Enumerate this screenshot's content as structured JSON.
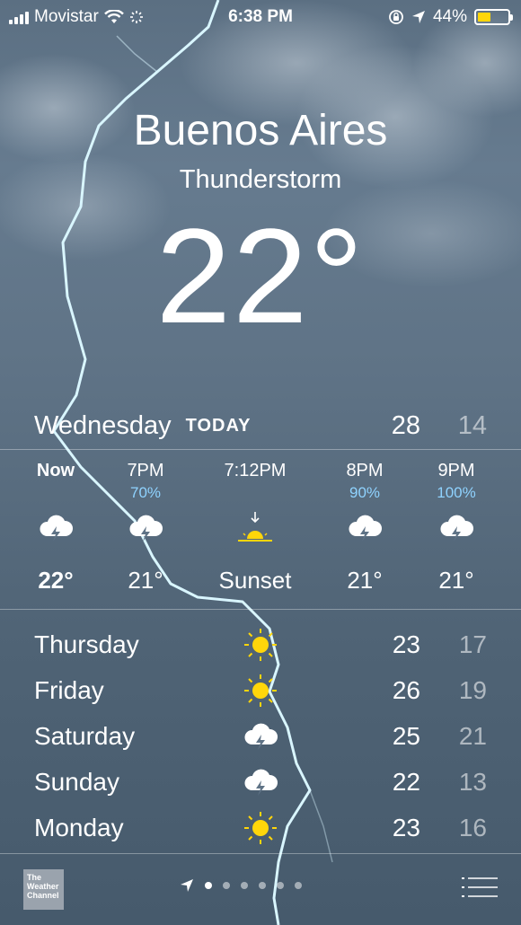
{
  "status_bar": {
    "carrier": "Movistar",
    "time": "6:38 PM",
    "battery_percent": "44%",
    "battery_level": 0.44,
    "icons": [
      "signal-icon",
      "wifi-icon",
      "activity-icon",
      "orientation-lock-icon",
      "location-arrow-icon",
      "battery-icon"
    ]
  },
  "location": {
    "city": "Buenos Aires",
    "condition": "Thunderstorm",
    "temperature": "22°"
  },
  "today": {
    "day": "Wednesday",
    "tag": "TODAY",
    "high": "28",
    "low": "14"
  },
  "hourly": [
    {
      "time": "Now",
      "precip": "",
      "icon": "thunderstorm-icon",
      "temp": "22°"
    },
    {
      "time": "7PM",
      "precip": "70%",
      "icon": "thunderstorm-icon",
      "temp": "21°"
    },
    {
      "time": "7:12PM",
      "precip": "",
      "icon": "sunset-icon",
      "temp": "Sunset"
    },
    {
      "time": "8PM",
      "precip": "90%",
      "icon": "thunderstorm-icon",
      "temp": "21°"
    },
    {
      "time": "9PM",
      "precip": "100%",
      "icon": "thunderstorm-icon",
      "temp": "21°"
    }
  ],
  "daily": [
    {
      "day": "Thursday",
      "icon": "sun-icon",
      "high": "23",
      "low": "17"
    },
    {
      "day": "Friday",
      "icon": "sun-icon",
      "high": "26",
      "low": "19"
    },
    {
      "day": "Saturday",
      "icon": "thunderstorm-icon",
      "high": "25",
      "low": "21"
    },
    {
      "day": "Sunday",
      "icon": "thunderstorm-icon",
      "high": "22",
      "low": "13"
    },
    {
      "day": "Monday",
      "icon": "sun-icon",
      "high": "23",
      "low": "16"
    }
  ],
  "footer": {
    "logo_text": "The Weather Channel",
    "page_count": 7,
    "current_page": 0,
    "icons": [
      "location-arrow-icon",
      "list-icon"
    ]
  },
  "colors": {
    "sun": "#ffd60a",
    "precip": "#8fd3ff",
    "battery": "#ffd60a",
    "lightning": "#d9f6ff"
  }
}
